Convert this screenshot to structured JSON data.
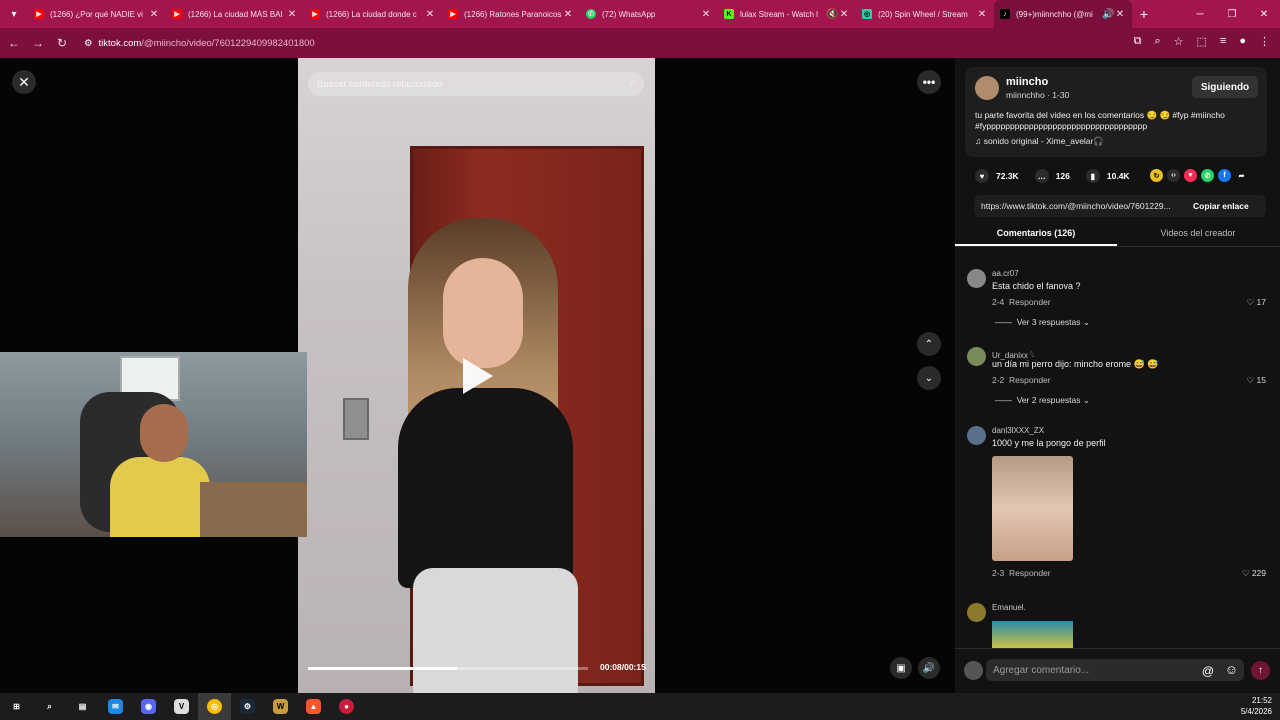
{
  "browser": {
    "tabs": [
      {
        "label": "(1266) ¿Por qué NADIE vi",
        "icon": "youtube-icon",
        "color": "#ff0000"
      },
      {
        "label": "(1266) La ciudad MÁS BAI",
        "icon": "youtube-icon",
        "color": "#ff0000"
      },
      {
        "label": "(1266) La ciudad donde c",
        "icon": "youtube-icon",
        "color": "#ff0000"
      },
      {
        "label": "(1266) Ratones Paranoicos",
        "icon": "youtube-icon",
        "color": "#ff0000"
      },
      {
        "label": "(72) WhatsApp",
        "icon": "whatsapp-icon",
        "color": "#25d366"
      },
      {
        "label": "lulax Stream - Watch l",
        "icon": "kick-icon",
        "color": "#53fc18"
      },
      {
        "label": "(20) Spin Wheel / Stream",
        "icon": "wheel-icon",
        "color": "#2bd1a7"
      },
      {
        "label": "(99+)miinnchho (@mi",
        "icon": "tiktok-icon",
        "color": "#ffffff"
      }
    ],
    "url_site": "tiktok.com",
    "url_path": "/@miincho/video/7601229409982401800"
  },
  "video": {
    "search_placeholder": "Buscar contenido relacionado",
    "progress": 0.533,
    "time": "00:08/00:15"
  },
  "creator": {
    "username": "miincho",
    "handle": "miinnchho · 1-30",
    "follow_label": "Siguiendo",
    "description": "tu parte favorita del video en los comentarios 😏 😏 #fyp #miincho #fypppppppppppppppppppppppppppppppppp",
    "sound": "sonido original - Xime_avelar🎧"
  },
  "stats": {
    "likes": "72.3K",
    "comments": "126",
    "saves": "10.4K"
  },
  "link": {
    "url": "https://www.tiktok.com/@miincho/video/7601229...",
    "copy_label": "Copiar enlace"
  },
  "panel_tabs": {
    "comments": "Comentarios (126)",
    "creator_videos": "Videos del creador"
  },
  "comments": [
    {
      "user": "aa.cr07",
      "text": "Esta chido el fanova ?",
      "date": "2-4",
      "reply": "Responder",
      "likes": "17",
      "replies": "Ver 3 respuestas"
    },
    {
      "user": "Ur_danixx 𓆩",
      "text": "un día mi perro dijo: mincho erome 😅 😅",
      "date": "2-2",
      "reply": "Responder",
      "likes": "15",
      "replies": "Ver 2 respuestas"
    },
    {
      "user": "danl3lXXX_ZX",
      "text": "1000 y me la pongo de perfil",
      "date": "2-3",
      "reply": "Responder",
      "likes": "229"
    },
    {
      "user": "Emanuel."
    }
  ],
  "add_comment_placeholder": "Agregar comentario...",
  "taskbar": {
    "time": "21:52",
    "date": "5/4/2026"
  },
  "colors": {
    "tabbar": "#a3154f",
    "addressbar": "#7d0f3e"
  }
}
